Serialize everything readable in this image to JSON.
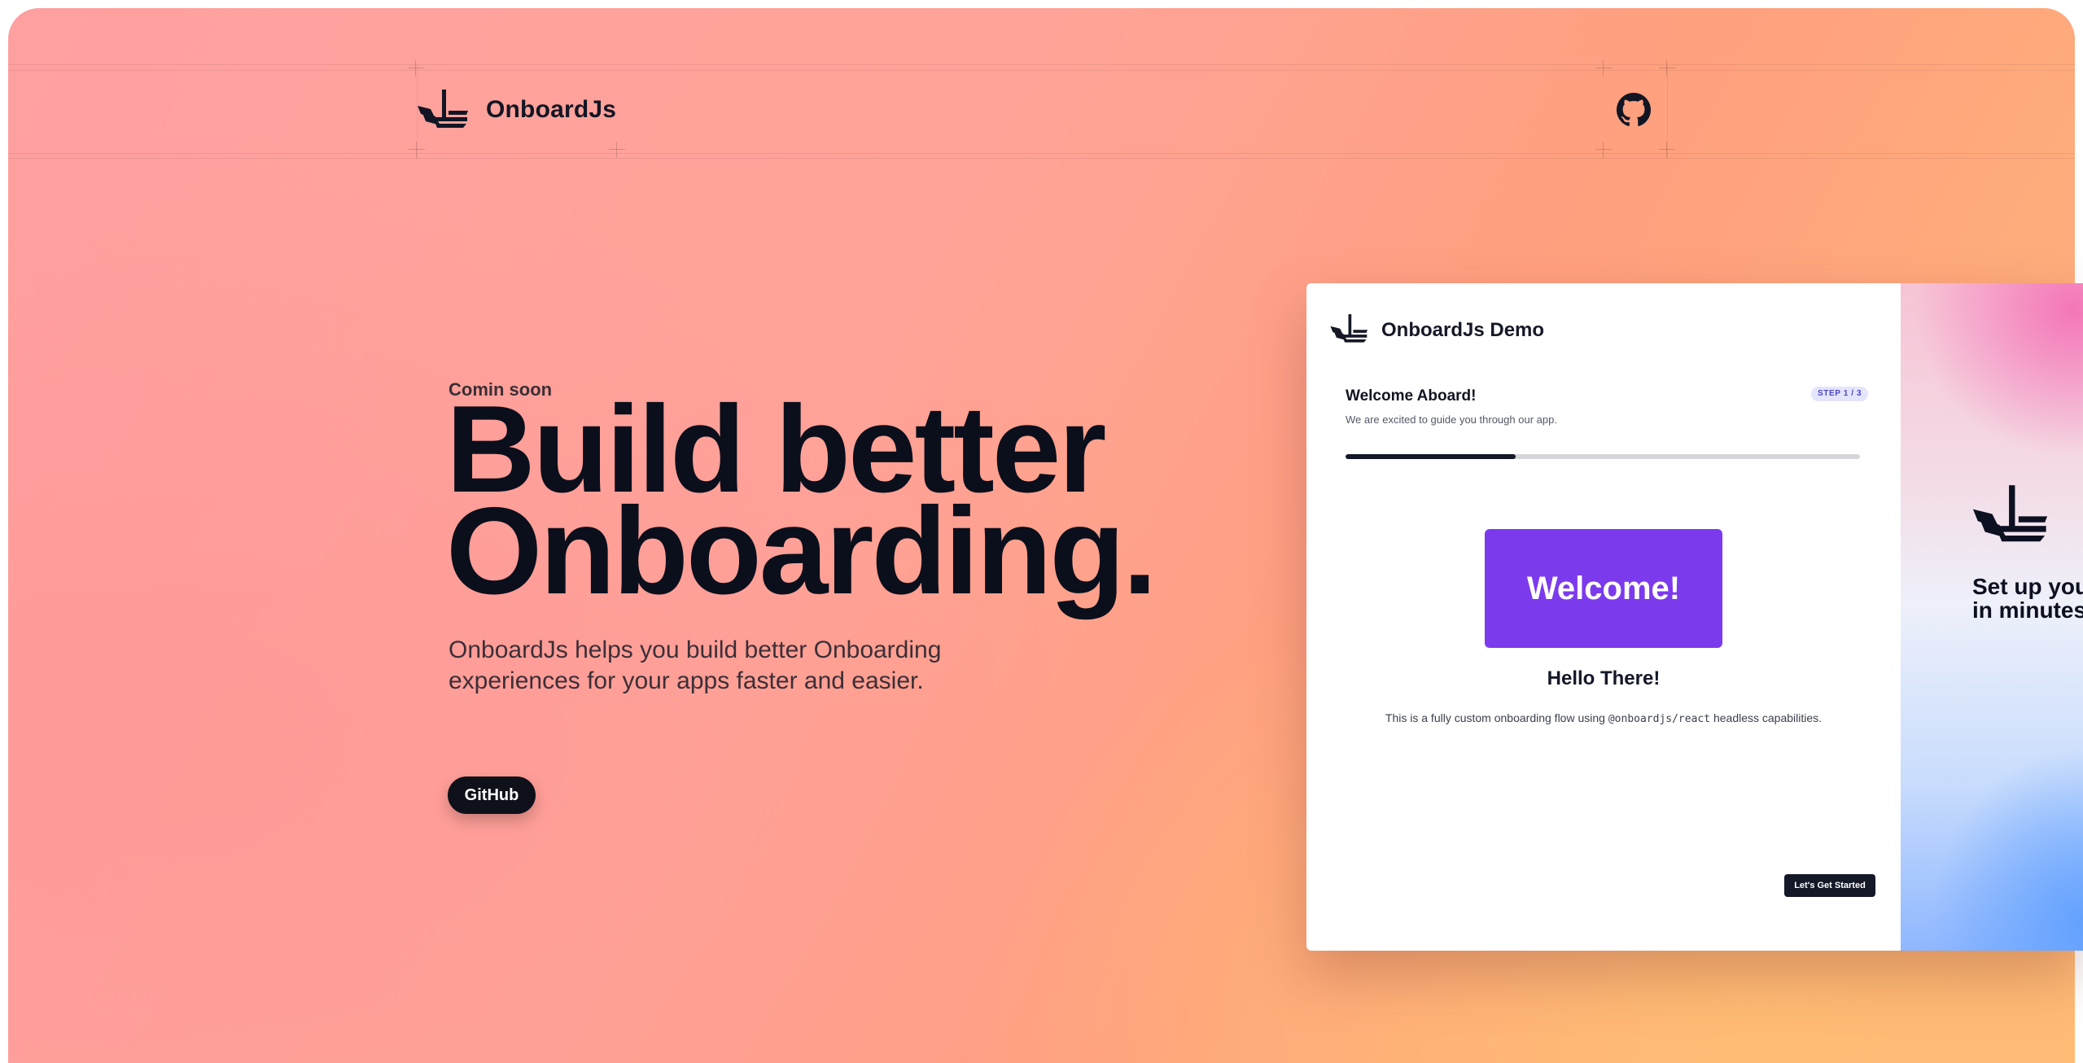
{
  "nav": {
    "brand": "OnboardJs"
  },
  "hero": {
    "eyebrow": "Comin soon",
    "title_line1": "Build better",
    "title_line2": "Onboarding.",
    "description": "OnboardJs helps you build better Onboarding experiences for your apps faster and easier.",
    "github_button": "GitHub"
  },
  "demo": {
    "title": "OnboardJs Demo",
    "step_title": "Welcome Aboard!",
    "step_subtitle": "We are excited to guide you through our app.",
    "step_badge": "STEP 1 / 3",
    "progress": 0.33,
    "welcome_card": "Welcome!",
    "heading": "Hello There!",
    "desc_before": "This is a fully custom onboarding flow using ",
    "desc_code": "@onboardjs/react",
    "desc_after": " headless capabilities.",
    "start_button": "Let's Get Started",
    "side_text": "Set up your\nin minutes"
  },
  "colors": {
    "accent": "#7c3aed",
    "dark": "#141827",
    "badge_bg": "#e4e4fc",
    "badge_text": "#4b44c9"
  }
}
